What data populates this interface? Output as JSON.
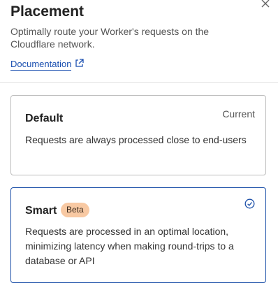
{
  "panel": {
    "title": "Placement",
    "description": "Optimally route your Worker's requests on the Cloudflare network.",
    "documentation_link": "Documentation"
  },
  "options": [
    {
      "title": "Default",
      "status": "Current",
      "description": "Requests are always processed close to end-users"
    },
    {
      "title": "Smart",
      "badge": "Beta",
      "description": "Requests are processed in an optimal location, minimizing latency when making round-trips to a database or API",
      "selected": true
    }
  ],
  "colors": {
    "accent": "#1b4fa8",
    "link": "#1a4fb0",
    "badge_bg": "#f8c9a3"
  }
}
